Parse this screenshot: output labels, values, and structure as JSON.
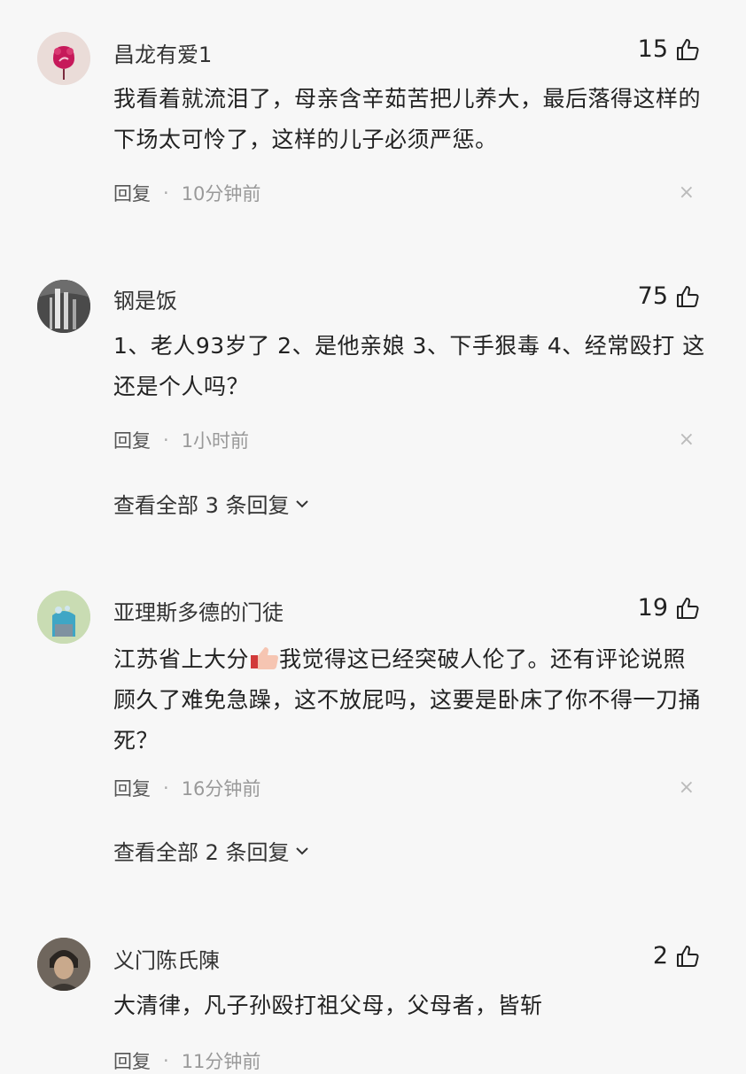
{
  "comments": [
    {
      "user": "昌龙有爱1",
      "likes": "15",
      "text": "我看着就流泪了，母亲含辛茹苦把儿养大，最后落得这样的下场太可怜了，这样的儿子必须严惩。",
      "reply_label": "回复",
      "separator": "·",
      "time": "10分钟前",
      "avatar": "rose-avatar"
    },
    {
      "user": "钢是饭",
      "likes": "75",
      "text": "1、老人93岁了 2、是他亲娘 3、下手狠毒 4、经常殴打 这还是个人吗？",
      "reply_label": "回复",
      "separator": "·",
      "time": "1小时前",
      "view_replies": "查看全部 3 条回复",
      "avatar": "waterfall-avatar"
    },
    {
      "user": "亚理斯多德的门徒",
      "likes": "19",
      "text_before_emoji": "江苏省上大分",
      "text_after_emoji": "我觉得这已经突破人伦了。还有评论说照顾久了难免急躁，这不放屁吗，这要是卧床了你不得一刀捅死？",
      "emoji": "thumbs-up-emoji",
      "reply_label": "回复",
      "separator": "·",
      "time": "16分钟前",
      "view_replies": "查看全部 2 条回复",
      "avatar": "blue-figure-avatar"
    },
    {
      "user": "义门陈氏陳",
      "likes": "2",
      "text": "大清律，凡子孙殴打祖父母，父母者，皆斩",
      "reply_label": "回复",
      "separator": "·",
      "time": "11分钟前",
      "avatar": "man-portrait-avatar"
    }
  ],
  "close_glyph": "×",
  "icons": {
    "like": "thumbs-up-icon",
    "expand": "chevron-down-icon"
  }
}
